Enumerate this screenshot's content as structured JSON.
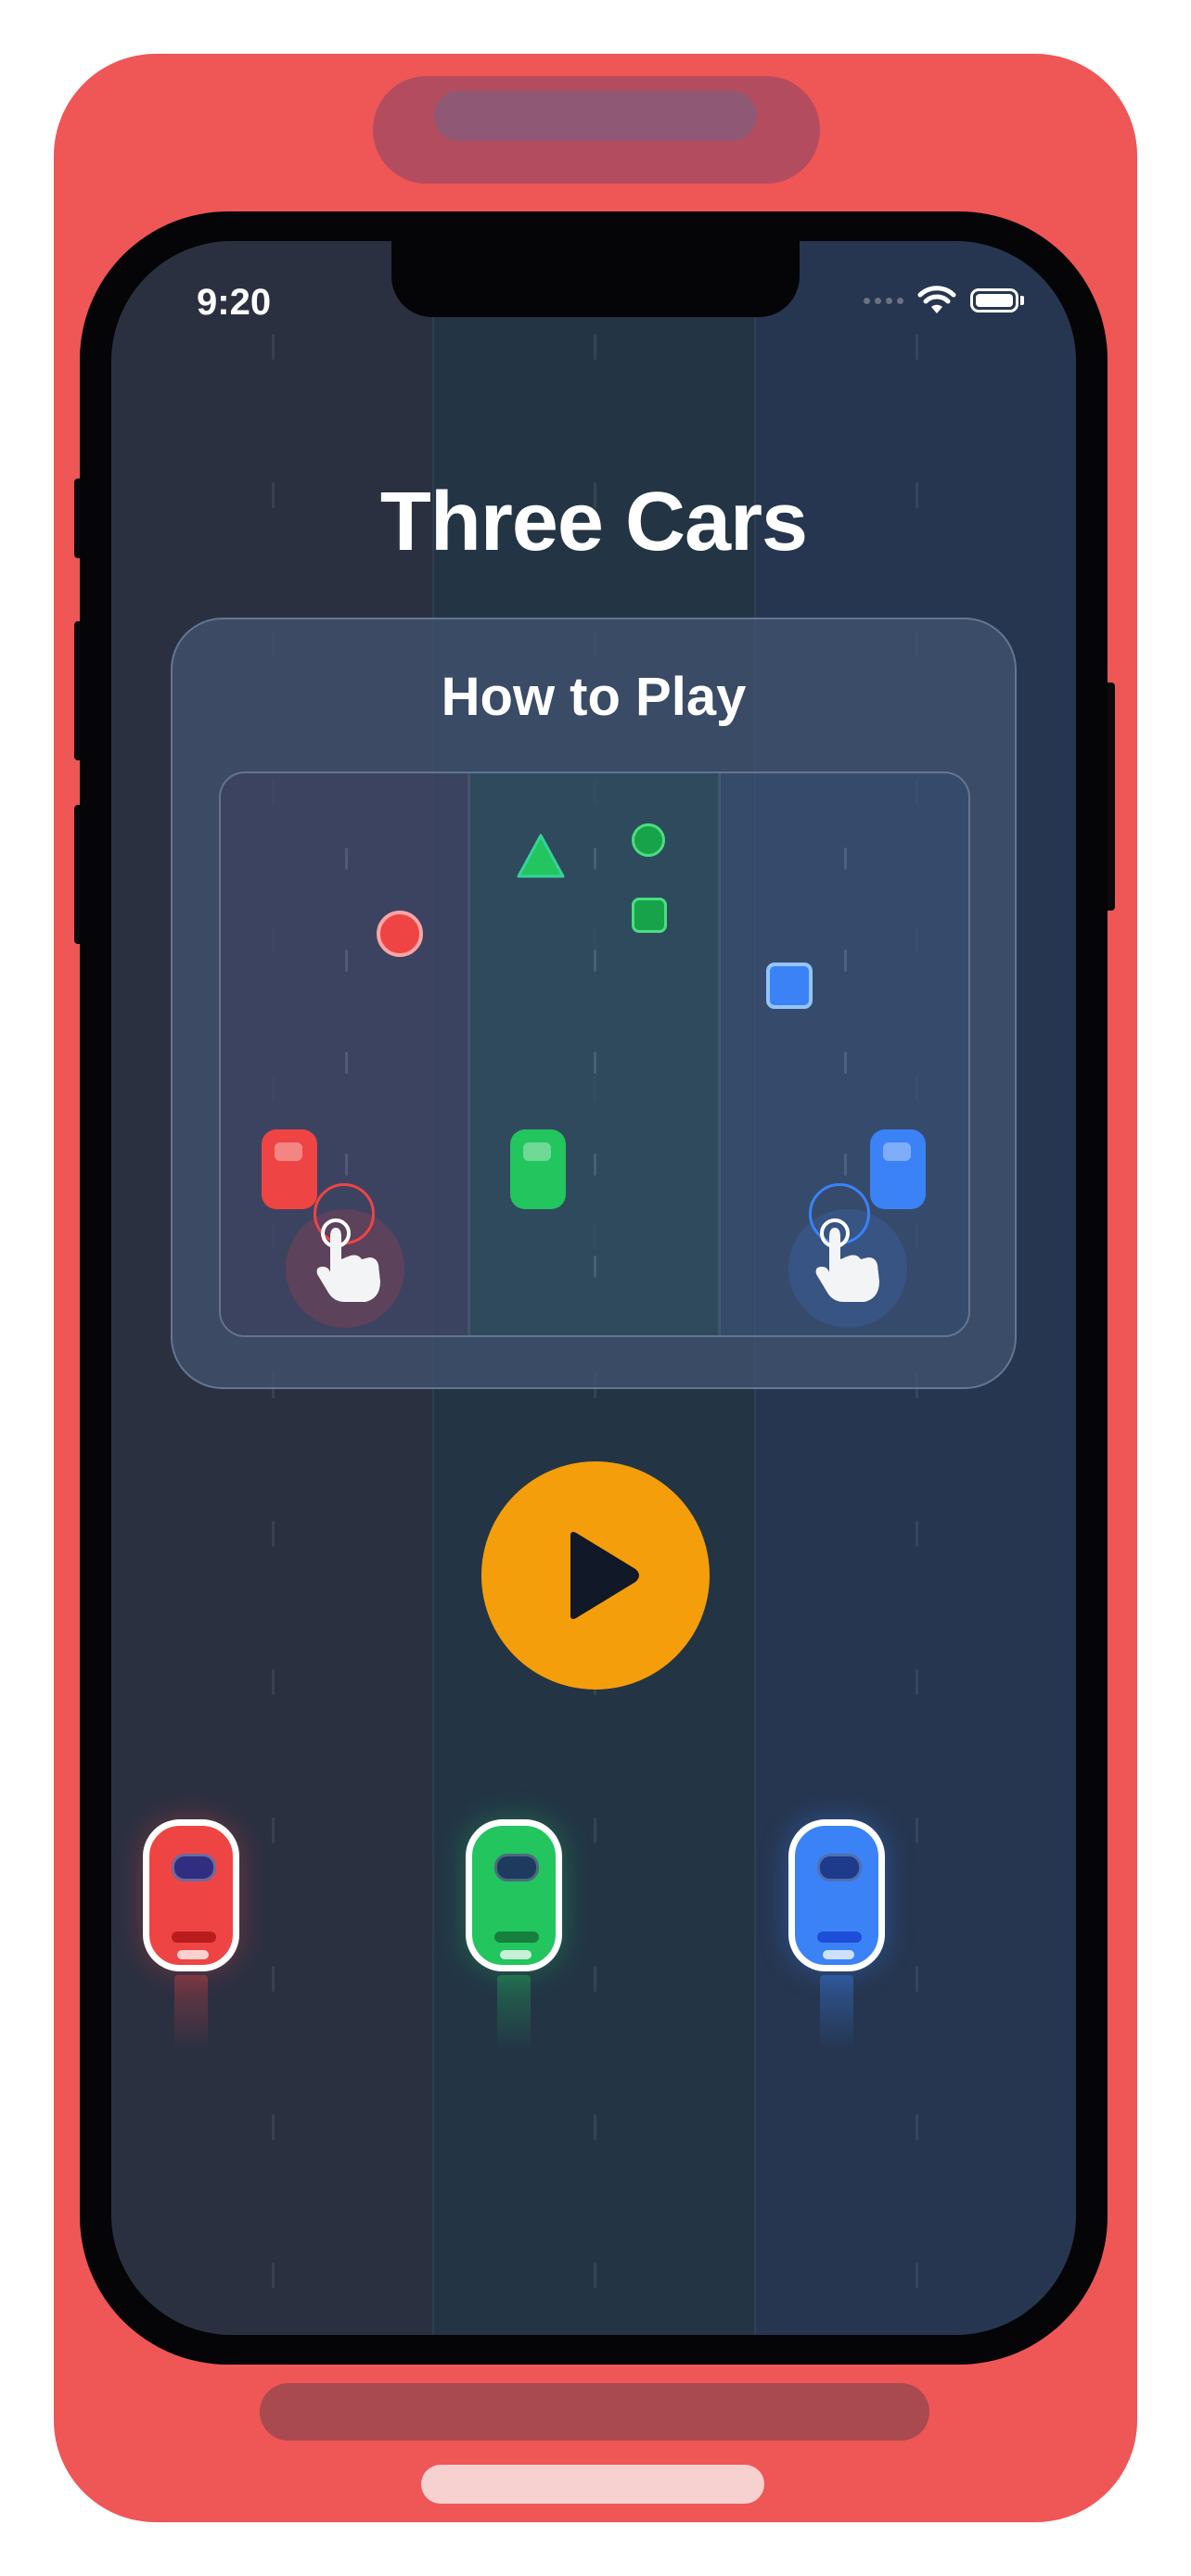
{
  "status_bar": {
    "time": "9:20"
  },
  "app": {
    "title": "Three Cars"
  },
  "how_to_play": {
    "title": "How to Play"
  },
  "colors": {
    "case": "#ef5656",
    "lane_left": "#2b3041",
    "lane_middle": "#233545",
    "lane_right": "#263650",
    "red_car": "#ef4444",
    "green_car": "#22c55e",
    "blue_car": "#3b82f6",
    "play_button": "#f59e0b"
  },
  "icons": {
    "play": "play-icon",
    "tap": "hand-tap-icon",
    "wifi": "wifi-icon",
    "battery": "battery-icon",
    "signal": "signal-dots-icon"
  },
  "cars": [
    {
      "color": "red"
    },
    {
      "color": "green"
    },
    {
      "color": "blue"
    }
  ]
}
